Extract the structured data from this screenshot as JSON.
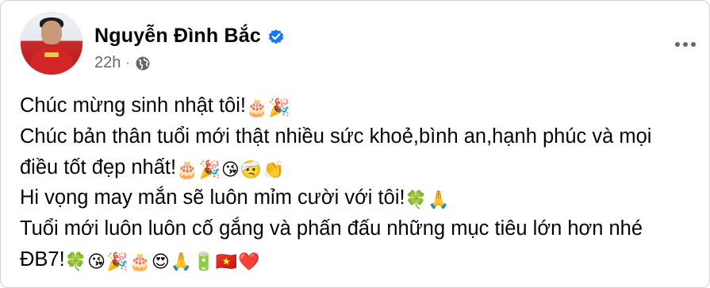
{
  "post": {
    "author": "Nguyễn Đình Bắc",
    "time": "22h",
    "separator": "·",
    "lines": [
      {
        "text": "Chúc mừng sinh nhật tôi!",
        "emojis": [
          "🎂",
          "🎉"
        ]
      },
      {
        "text": "Chúc bản thân tuổi mới thật nhiều sức khoẻ,bình an,hạnh phúc và mọi",
        "emojis": []
      },
      {
        "text": "điều tốt đẹp nhất!",
        "emojis": [
          "🎂",
          "🎉",
          "😘",
          "🤕",
          "👏"
        ]
      },
      {
        "text": "Hi vọng may mắn sẽ luôn mỉm cười với tôi!",
        "emojis": [
          "🍀",
          "🙏"
        ]
      },
      {
        "text": "Tuổi mới luôn luôn cố gắng và phấn đấu những mục tiêu lớn hơn nhé",
        "emojis": []
      },
      {
        "text": "ĐB7!",
        "emojis": [
          "🍀",
          "😘",
          "🎉",
          "🎂",
          "😍",
          "🙏",
          "🔋",
          "🇻🇳",
          "❤️"
        ]
      }
    ]
  },
  "icons": {
    "verified": "verified-badge-icon",
    "audience": "globe-icon",
    "more": "more-options-icon"
  },
  "colors": {
    "verified_blue": "#1877f2",
    "secondary_text": "#65676b",
    "primary_text": "#050505",
    "border": "#cfd3d8"
  }
}
